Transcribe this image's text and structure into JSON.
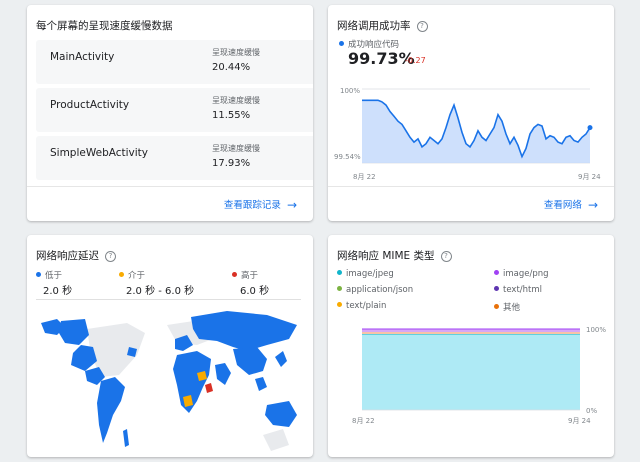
{
  "slow_render": {
    "title": "每个屏幕的呈现速度缓慢数据",
    "rows": [
      {
        "name": "MainActivity",
        "label": "呈现速度缓慢",
        "value": "20.44%"
      },
      {
        "name": "ProductActivity",
        "label": "呈现速度缓慢",
        "value": "11.55%"
      },
      {
        "name": "SimpleWebActivity",
        "label": "呈现速度缓慢",
        "value": "17.93%"
      }
    ],
    "link": "查看跟踪记录"
  },
  "success": {
    "title": "网络调用成功率",
    "legend": "成功响应代码",
    "value": "99.73%",
    "delta": "-0.27",
    "link": "查看网络",
    "chart_data": {
      "type": "area",
      "x_labels": [
        "8月 22",
        "9月 24"
      ],
      "y_labels": [
        "100%",
        "99.54%"
      ],
      "ylim": [
        99.54,
        100
      ],
      "series": [
        {
          "name": "成功响应代码",
          "color": "#1a73e8",
          "values": [
            99.93,
            99.93,
            99.93,
            99.93,
            99.93,
            99.92,
            99.9,
            99.86,
            99.83,
            99.8,
            99.78,
            99.74,
            99.7,
            99.67,
            99.69,
            99.64,
            99.66,
            99.7,
            99.68,
            99.66,
            99.69,
            99.76,
            99.84,
            99.9,
            99.82,
            99.73,
            99.66,
            99.64,
            99.68,
            99.74,
            99.7,
            99.68,
            99.72,
            99.76,
            99.84,
            99.8,
            99.72,
            99.66,
            99.7,
            99.65,
            99.58,
            99.63,
            99.72,
            99.76,
            99.78,
            99.77,
            99.69,
            99.71,
            99.7,
            99.67,
            99.66,
            99.7,
            99.71,
            99.68,
            99.67,
            99.7,
            99.72,
            99.76
          ]
        }
      ]
    }
  },
  "latency": {
    "title": "网络响应延迟",
    "legend": [
      {
        "label": "低于",
        "value": "2.0 秒",
        "color": "#1a73e8"
      },
      {
        "label": "介于",
        "value": "2.0 秒 - 6.0 秒",
        "color": "#f9ab00"
      },
      {
        "label": "高于",
        "value": "6.0 秒",
        "color": "#d93025"
      }
    ]
  },
  "mime": {
    "title": "网络响应 MIME 类型",
    "legend": [
      {
        "label": "image/jpeg",
        "color": "#12b5cb"
      },
      {
        "label": "image/png",
        "color": "#a142f4"
      },
      {
        "label": "application/json",
        "color": "#7cb342"
      },
      {
        "label": "text/html",
        "color": "#5e35b1"
      },
      {
        "label": "text/plain",
        "color": "#f9ab00"
      },
      {
        "label": "其他",
        "color": "#e8710a"
      }
    ],
    "chart_data": {
      "type": "area",
      "x_labels": [
        "8月 22",
        "9月 24"
      ],
      "y_labels": [
        "100%",
        "0%"
      ],
      "ylim": [
        0,
        100
      ],
      "series": [
        {
          "name": "image/jpeg",
          "share": 96
        },
        {
          "name": "其他",
          "share": 1.5
        },
        {
          "name": "image/png",
          "share": 2.5
        }
      ]
    }
  }
}
